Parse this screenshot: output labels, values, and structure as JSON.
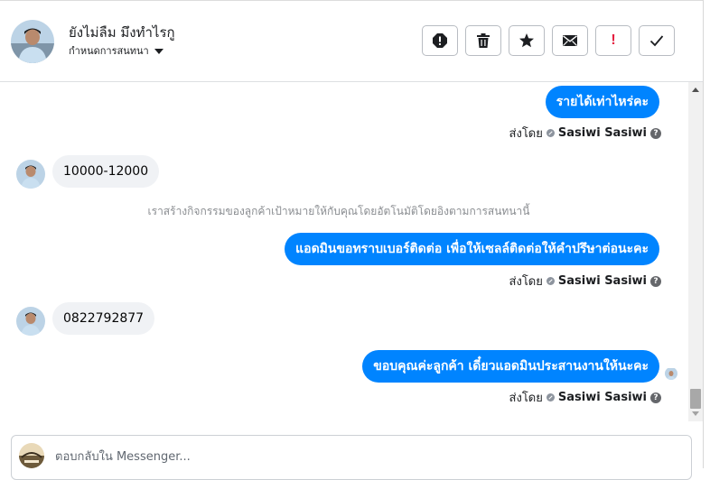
{
  "header": {
    "contact_name": "ยังไม่ลืม มึงทำไรกู",
    "conversation_menu_label": "กำหนดการสนทนา",
    "actions": [
      {
        "id": "spam",
        "icon": "alert-circle-icon"
      },
      {
        "id": "delete",
        "icon": "trash-icon"
      },
      {
        "id": "star",
        "icon": "star-icon"
      },
      {
        "id": "unread",
        "icon": "envelope-icon"
      },
      {
        "id": "follow-up",
        "icon": "exclamation-icon",
        "glyph": "!",
        "color": "#e41e3f"
      },
      {
        "id": "done",
        "icon": "checkmark-icon"
      }
    ]
  },
  "messages": [
    {
      "type": "outgoing",
      "text": "รายได้เท่าไหร่คะ"
    },
    {
      "type": "sent_by",
      "label": "ส่งโดย",
      "name": "Sasiwi Sasiwi",
      "help": "?"
    },
    {
      "type": "incoming",
      "text": "10000-12000"
    },
    {
      "type": "system",
      "text": "เราสร้างกิจกรรมของลูกค้าเป้าหมายให้กับคุณโดยอัตโนมัติโดยอิงตามการสนทนานี้"
    },
    {
      "type": "outgoing",
      "text": "แอดมินขอทราบเบอร์ติดต่อ เพื่อให้เซลล์ติดต่อให้คำปรึษาต่อนะคะ"
    },
    {
      "type": "sent_by",
      "label": "ส่งโดย",
      "name": "Sasiwi Sasiwi",
      "help": "?"
    },
    {
      "type": "incoming",
      "text": "0822792877"
    },
    {
      "type": "outgoing",
      "text": "ขอบคุณค่ะลูกค้า เดี๋ยวแอดมินประสานงานให้นะคะ"
    },
    {
      "type": "sent_by",
      "label": "ส่งโดย",
      "name": "Sasiwi Sasiwi",
      "help": "?"
    }
  ],
  "composer": {
    "placeholder": "ตอบกลับใน Messenger..."
  },
  "colors": {
    "outgoing_bubble": "#0084ff",
    "incoming_bubble": "#f0f2f5",
    "system_text": "#8a8d91",
    "alert_red": "#e41e3f"
  }
}
